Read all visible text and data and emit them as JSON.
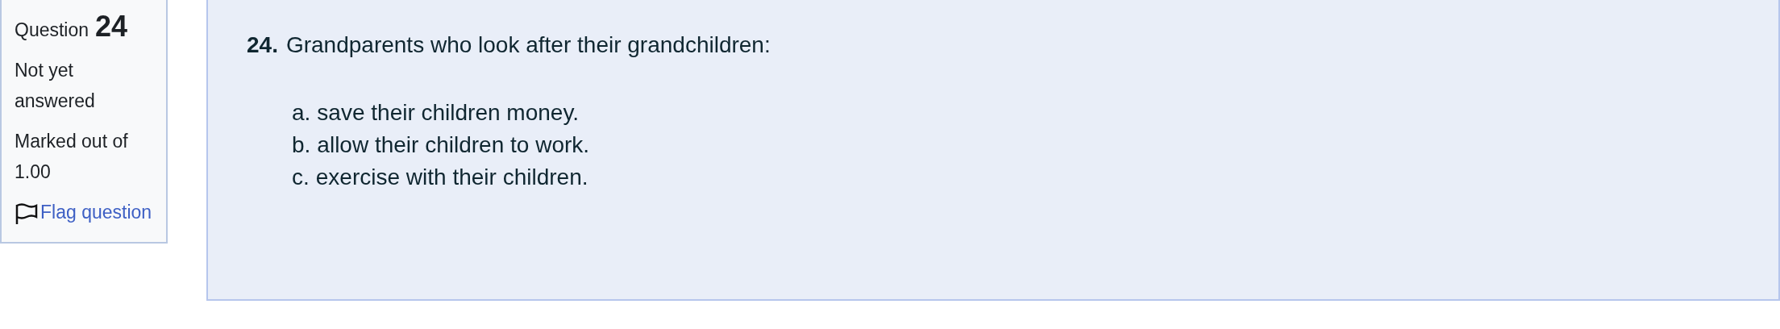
{
  "info": {
    "label": "Question",
    "number": "24",
    "status": "Not yet answered",
    "marks": "Marked out of 1.00",
    "flag_link": "Flag question",
    "flagged": false
  },
  "question": {
    "number": "24.",
    "text": "Grandparents who look after their grandchildren:",
    "options": [
      {
        "letter": "a.",
        "text": "save their children money."
      },
      {
        "letter": "b.",
        "text": "allow their children to work."
      },
      {
        "letter": "c.",
        "text": "exercise with their children."
      }
    ]
  }
}
